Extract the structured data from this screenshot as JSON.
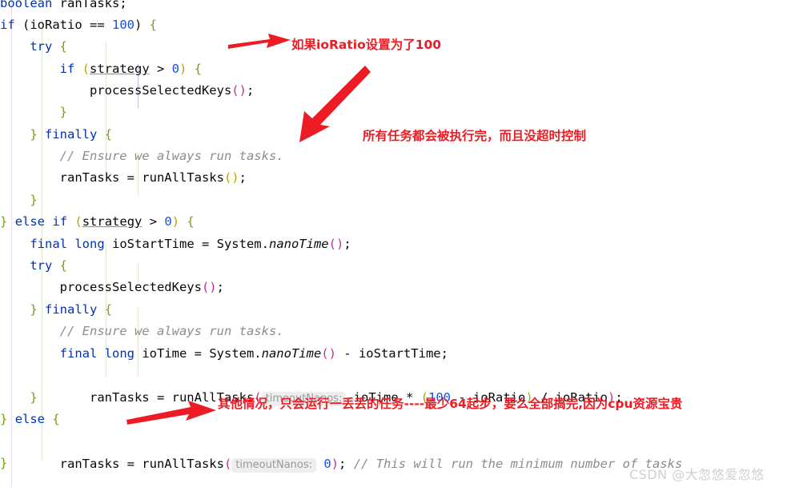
{
  "editor": {
    "language": "java",
    "background_color": "#ffffff",
    "margin_guide_color": "#e8d9f0",
    "indent_guide_color": "#dfead2",
    "indent_guide_active_color": "#b9c4d6",
    "lines": [
      {
        "id": "l1",
        "text": "boolean ranTasks;"
      },
      {
        "id": "l2",
        "text": "if (ioRatio == 100) {"
      },
      {
        "id": "l3",
        "text": "    try {"
      },
      {
        "id": "l4",
        "text": "        if (strategy > 0) {"
      },
      {
        "id": "l5",
        "text": "            processSelectedKeys();"
      },
      {
        "id": "l6",
        "text": "        }"
      },
      {
        "id": "l7",
        "text": "    } finally {"
      },
      {
        "id": "l8",
        "text": "        // Ensure we always run tasks."
      },
      {
        "id": "l9",
        "text": "        ranTasks = runAllTasks();"
      },
      {
        "id": "l10",
        "text": "    }"
      },
      {
        "id": "l11",
        "text": "} else if (strategy > 0) {"
      },
      {
        "id": "l12",
        "text": "    final long ioStartTime = System.nanoTime();"
      },
      {
        "id": "l13",
        "text": "    try {"
      },
      {
        "id": "l14",
        "text": "        processSelectedKeys();"
      },
      {
        "id": "l15",
        "text": "    } finally {"
      },
      {
        "id": "l16",
        "text": "        // Ensure we always run tasks."
      },
      {
        "id": "l17",
        "text": "        final long ioTime = System.nanoTime() - ioStartTime;"
      },
      {
        "id": "l18",
        "text": "        ranTasks = runAllTasks( timeoutNanos: ioTime * (100 - ioRatio) / ioRatio);"
      },
      {
        "id": "l19",
        "text": "    }"
      },
      {
        "id": "l20",
        "text": "} else {"
      },
      {
        "id": "l21",
        "text": "    ranTasks = runAllTasks( timeoutNanos: 0); // This will run the minimum number of tasks"
      },
      {
        "id": "l22",
        "text": "}"
      }
    ],
    "parameter_hints": [
      {
        "id": "hint1",
        "label": "timeoutNanos:"
      },
      {
        "id": "hint2",
        "label": "timeoutNanos:"
      }
    ],
    "comments": [
      {
        "id": "c1",
        "text": "// Ensure we always run tasks."
      },
      {
        "id": "c2",
        "text": "// Ensure we always run tasks."
      },
      {
        "id": "c3",
        "text": "// This will run the minimum number of tasks"
      }
    ]
  },
  "annotations": {
    "color": "#ed1c24",
    "items": [
      {
        "id": "a1",
        "text": "如果ioRatio设置为了100",
        "arrow": "horizontal-right"
      },
      {
        "id": "a2",
        "text": "所有任务都会被执行完，而且没超时控制",
        "arrow": "diagonal-down-left"
      },
      {
        "id": "a3",
        "text": "其他情况，只会运行一丢丢的任务----最少64起步，要么全部搞完,因为cpu资源宝贵",
        "arrow": "horizontal-right"
      }
    ]
  },
  "watermark": {
    "text": "CSDN @大忽悠爱忽悠",
    "color": "#d0d0d0"
  },
  "tokens": {
    "l1": [
      {
        "t": "boolean",
        "c": "kw"
      },
      {
        "t": " ranTasks;",
        "c": "plain"
      }
    ],
    "l2": [
      {
        "t": "if",
        "c": "kw"
      },
      {
        "t": " (ioRatio == ",
        "c": "plain"
      },
      {
        "t": "100",
        "c": "num"
      },
      {
        "t": ") ",
        "c": "plain"
      },
      {
        "t": "{",
        "c": "brace"
      }
    ],
    "l3": [
      {
        "t": "    ",
        "c": "plain"
      },
      {
        "t": "try",
        "c": "kw"
      },
      {
        "t": " ",
        "c": "plain"
      },
      {
        "t": "{",
        "c": "brace"
      }
    ],
    "l4": [
      {
        "t": "        ",
        "c": "plain"
      },
      {
        "t": "if",
        "c": "kw"
      },
      {
        "t": " ",
        "c": "plain"
      },
      {
        "t": "(",
        "c": "paren2"
      },
      {
        "t": "strategy",
        "c": "stat"
      },
      {
        "t": " > ",
        "c": "plain"
      },
      {
        "t": "0",
        "c": "num"
      },
      {
        "t": ")",
        "c": "paren2"
      },
      {
        "t": " ",
        "c": "plain"
      },
      {
        "t": "{",
        "c": "brace"
      }
    ],
    "l5": [
      {
        "t": "            processSelectedKeys",
        "c": "plain"
      },
      {
        "t": "()",
        "c": "paren"
      },
      {
        "t": ";",
        "c": "plain"
      }
    ],
    "l6": [
      {
        "t": "        ",
        "c": "plain"
      },
      {
        "t": "}",
        "c": "brace"
      }
    ],
    "l7": [
      {
        "t": "    ",
        "c": "plain"
      },
      {
        "t": "}",
        "c": "brace"
      },
      {
        "t": " ",
        "c": "plain"
      },
      {
        "t": "finally",
        "c": "kw"
      },
      {
        "t": " ",
        "c": "plain"
      },
      {
        "t": "{",
        "c": "brace"
      }
    ],
    "l8": [
      {
        "t": "        ",
        "c": "plain"
      },
      {
        "t": "// Ensure we always run tasks.",
        "c": "cmt"
      }
    ],
    "l9": [
      {
        "t": "        ranTasks = runAllTasks",
        "c": "plain"
      },
      {
        "t": "()",
        "c": "paren2"
      },
      {
        "t": ";",
        "c": "plain"
      }
    ],
    "l10": [
      {
        "t": "    ",
        "c": "plain"
      },
      {
        "t": "}",
        "c": "brace"
      }
    ],
    "l11": [
      {
        "t": "}",
        "c": "brace"
      },
      {
        "t": " ",
        "c": "plain"
      },
      {
        "t": "else",
        "c": "kw"
      },
      {
        "t": " ",
        "c": "plain"
      },
      {
        "t": "if",
        "c": "kw"
      },
      {
        "t": " ",
        "c": "plain"
      },
      {
        "t": "(",
        "c": "paren2"
      },
      {
        "t": "strategy",
        "c": "stat"
      },
      {
        "t": " > ",
        "c": "plain"
      },
      {
        "t": "0",
        "c": "num"
      },
      {
        "t": ")",
        "c": "paren2"
      },
      {
        "t": " ",
        "c": "plain"
      },
      {
        "t": "{",
        "c": "brace"
      }
    ],
    "l12": [
      {
        "t": "    ",
        "c": "plain"
      },
      {
        "t": "final",
        "c": "kw"
      },
      {
        "t": " ",
        "c": "plain"
      },
      {
        "t": "long",
        "c": "kw"
      },
      {
        "t": " ioStartTime = System.",
        "c": "plain"
      },
      {
        "t": "nanoTime",
        "c": "ital"
      },
      {
        "t": "()",
        "c": "paren"
      },
      {
        "t": ";",
        "c": "plain"
      }
    ],
    "l13": [
      {
        "t": "    ",
        "c": "plain"
      },
      {
        "t": "try",
        "c": "kw"
      },
      {
        "t": " ",
        "c": "plain"
      },
      {
        "t": "{",
        "c": "brace"
      }
    ],
    "l14": [
      {
        "t": "        processSelectedKeys",
        "c": "plain"
      },
      {
        "t": "()",
        "c": "paren"
      },
      {
        "t": ";",
        "c": "plain"
      }
    ],
    "l15": [
      {
        "t": "    ",
        "c": "plain"
      },
      {
        "t": "}",
        "c": "brace"
      },
      {
        "t": " ",
        "c": "plain"
      },
      {
        "t": "finally",
        "c": "kw"
      },
      {
        "t": " ",
        "c": "plain"
      },
      {
        "t": "{",
        "c": "brace"
      }
    ],
    "l16": [
      {
        "t": "        ",
        "c": "plain"
      },
      {
        "t": "// Ensure we always run tasks.",
        "c": "cmt"
      }
    ],
    "l17": [
      {
        "t": "        ",
        "c": "plain"
      },
      {
        "t": "final",
        "c": "kw"
      },
      {
        "t": " ",
        "c": "plain"
      },
      {
        "t": "long",
        "c": "kw"
      },
      {
        "t": " ioTime = System.",
        "c": "plain"
      },
      {
        "t": "nanoTime",
        "c": "ital"
      },
      {
        "t": "()",
        "c": "paren"
      },
      {
        "t": " - ioStartTime;",
        "c": "plain"
      }
    ],
    "l19": [
      {
        "t": "    ",
        "c": "plain"
      },
      {
        "t": "}",
        "c": "brace"
      }
    ],
    "l20": [
      {
        "t": "}",
        "c": "brace"
      },
      {
        "t": " ",
        "c": "plain"
      },
      {
        "t": "else",
        "c": "kw"
      },
      {
        "t": " ",
        "c": "plain"
      },
      {
        "t": "{",
        "c": "brace"
      }
    ],
    "l22": [
      {
        "t": "}",
        "c": "brace"
      }
    ]
  }
}
